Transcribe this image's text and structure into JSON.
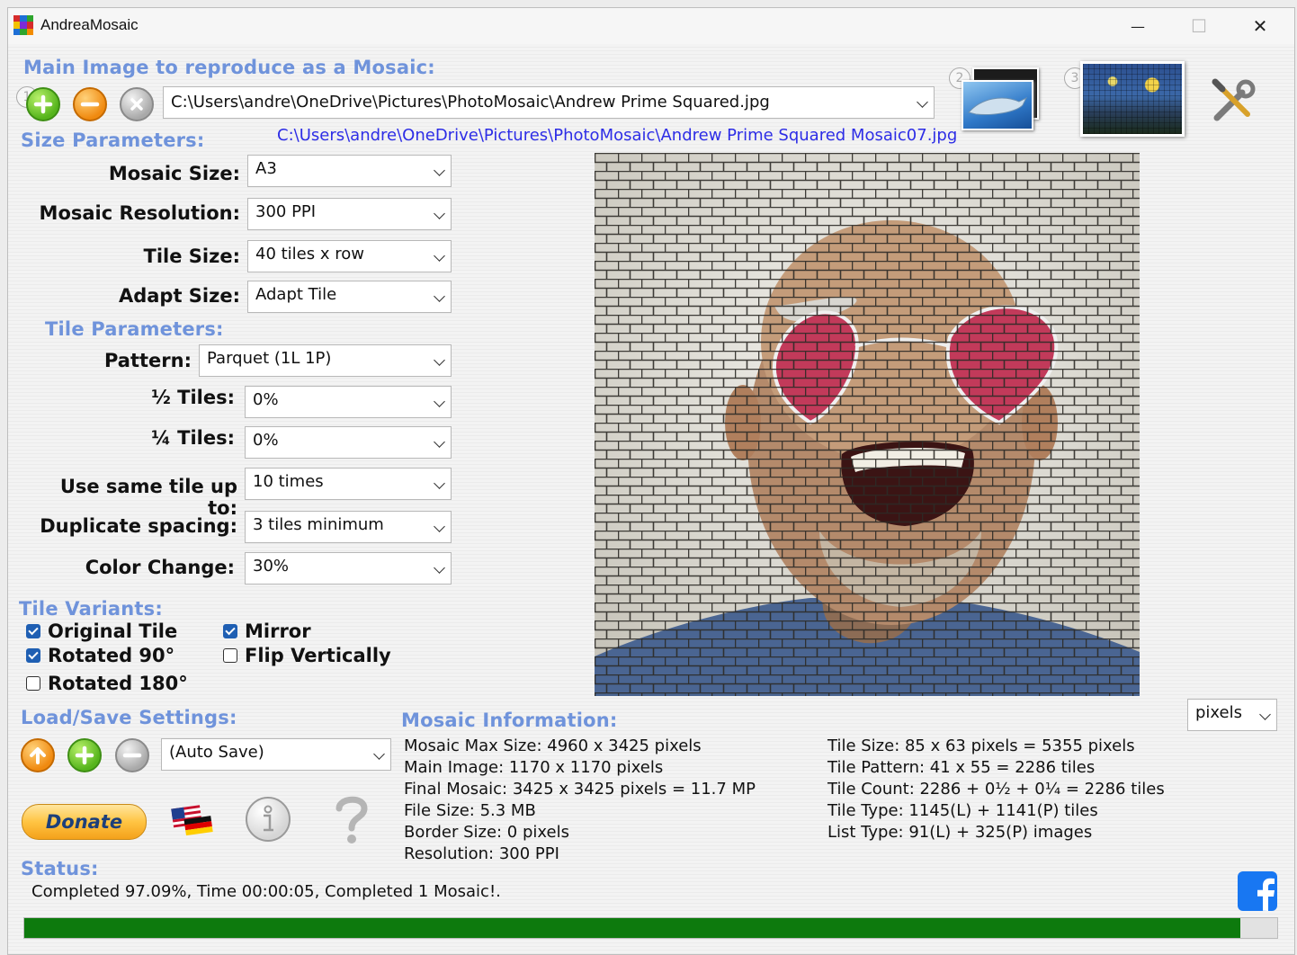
{
  "window": {
    "title": "AndreaMosaic",
    "minimize_glyph": "—",
    "maximize_glyph": "☐",
    "close_glyph": "✕"
  },
  "main_image": {
    "section_title": "Main Image to reproduce as a Mosaic:",
    "step_number": "1",
    "path": "C:\\Users\\andre\\OneDrive\\Pictures\\PhotoMosaic\\Andrew Prime Squared.jpg",
    "output_path": "C:\\Users\\andre\\OneDrive\\Pictures\\PhotoMosaic\\Andrew Prime Squared Mosaic07.jpg"
  },
  "steps": {
    "tiles_step": "2",
    "create_step": "3"
  },
  "size_parameters": {
    "section_title": "Size Parameters:",
    "fields": [
      {
        "label": "Mosaic Size:",
        "value": "A3"
      },
      {
        "label": "Mosaic Resolution:",
        "value": "300 PPI"
      },
      {
        "label": "Tile Size:",
        "value": "40 tiles x row"
      },
      {
        "label": "Adapt Size:",
        "value": "Adapt Tile"
      }
    ]
  },
  "tile_parameters": {
    "section_title": "Tile Parameters:",
    "fields": [
      {
        "label": "Pattern:",
        "value": "Parquet (1L 1P)"
      },
      {
        "label": "½ Tiles:",
        "value": "0%"
      },
      {
        "label": "¼ Tiles:",
        "value": "0%"
      },
      {
        "label": "Use same tile up to:",
        "value": "10 times"
      },
      {
        "label": "Duplicate spacing:",
        "value": "3 tiles minimum"
      },
      {
        "label": "Color Change:",
        "value": "30%"
      }
    ]
  },
  "tile_variants": {
    "section_title": "Tile Variants:",
    "options": [
      {
        "label": "Original Tile",
        "checked": true
      },
      {
        "label": "Mirror",
        "checked": true
      },
      {
        "label": "Rotated 90°",
        "checked": true
      },
      {
        "label": "Flip Vertically",
        "checked": false
      },
      {
        "label": "Rotated 180°",
        "checked": false
      }
    ]
  },
  "load_save": {
    "section_title": "Load/Save Settings:",
    "value": "(Auto Save)"
  },
  "buttons": {
    "donate_label": "Donate"
  },
  "mosaic_information": {
    "section_title": "Mosaic Information:",
    "unit": "pixels",
    "left": [
      "Mosaic Max Size: 4960 x 3425 pixels",
      "Main Image: 1170 x 1170 pixels",
      "Final Mosaic: 3425 x 3425 pixels = 11.7 MP",
      "File Size: 5.3 MB",
      "Border Size: 0 pixels",
      "Resolution: 300 PPI"
    ],
    "right": [
      "Tile Size: 85 x 63 pixels = 5355 pixels",
      "Tile Pattern: 41 x 55 = 2286 tiles",
      "Tile Count: 2286 + 0½ + 0¼ = 2286 tiles",
      "Tile Type: 1145(L) + 1141(P) tiles",
      "List Type: 91(L) + 325(P) images"
    ]
  },
  "status": {
    "section_title": "Status:",
    "message": "Completed 97.09%, Time 00:00:05, Completed 1 Mosaic!.",
    "progress": 0.9709
  },
  "colors": {
    "section_title": "#6f93db",
    "output_link": "#2d2de6",
    "progress_fill": "#0d7a0d",
    "facebook": "#1877f2"
  },
  "icons": {
    "add_main": "plus-icon",
    "remove_main": "minus-icon",
    "clear_main": "x-icon",
    "tiles_thumb": "dolphin-photo-icon",
    "mosaic_thumb": "starry-night-icon",
    "settings": "tools-icon",
    "load": "up-arrow-icon",
    "save": "plus-icon",
    "delete": "minus-icon",
    "language": "flags-icon",
    "info": "info-icon",
    "help": "question-icon",
    "facebook": "facebook-icon"
  }
}
